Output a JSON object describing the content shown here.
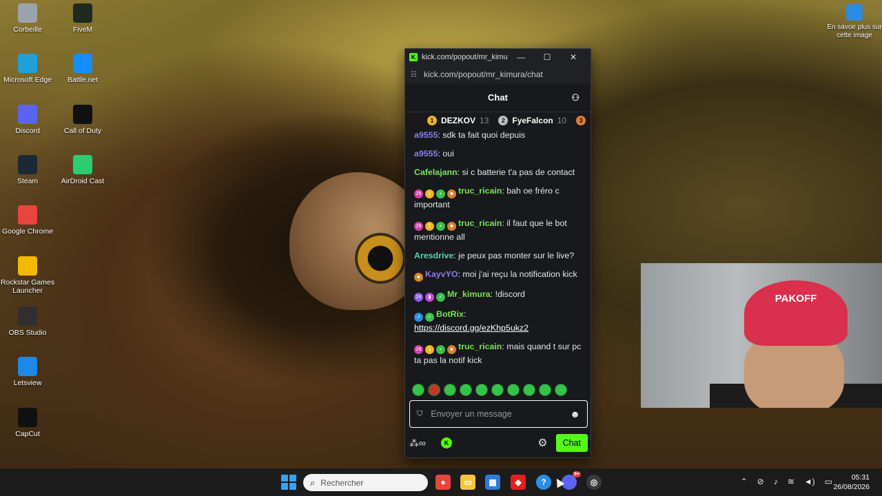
{
  "desktop": {
    "icons": [
      {
        "label": "Corbeille",
        "icon": "recycle-bin-icon",
        "color": "#9aa3ad"
      },
      {
        "label": "FiveM",
        "icon": "fivem-icon",
        "color": "#1f2a1f"
      },
      {
        "label": "Microsoft Edge",
        "icon": "edge-icon",
        "color": "#1fa0d8"
      },
      {
        "label": "Battle.net",
        "icon": "battlenet-icon",
        "color": "#148eff"
      },
      {
        "label": "Discord",
        "icon": "discord-icon",
        "color": "#5865f2"
      },
      {
        "label": "Call of Duty",
        "icon": "call-of-duty-icon",
        "color": "#111111"
      },
      {
        "label": "Steam",
        "icon": "steam-icon",
        "color": "#1b2838"
      },
      {
        "label": "AirDroid Cast",
        "icon": "airdroid-icon",
        "color": "#2ecc71"
      },
      {
        "label": "Google Chrome",
        "icon": "chrome-icon",
        "color": "#e8453c"
      },
      {
        "label": "Rockstar Games Launcher",
        "icon": "rockstar-icon",
        "color": "#f5b800"
      },
      {
        "label": "OBS Studio",
        "icon": "obs-icon",
        "color": "#302e31"
      },
      {
        "label": "Letsview",
        "icon": "letsview-icon",
        "color": "#1e88e5"
      },
      {
        "label": "CapCut",
        "icon": "capcut-icon",
        "color": "#111111"
      }
    ],
    "info_widget": "En savoir plus sur cette image"
  },
  "browser": {
    "tab_title": "kick.com/popout/mr_kimura...",
    "url": "kick.com/popout/mr_kimura/chat",
    "chat_title": "Chat",
    "leaderboard": [
      {
        "rank": "1",
        "name": "DEZKOV",
        "count": "13",
        "color": "#f0b429"
      },
      {
        "rank": "2",
        "name": "FyeFalcon",
        "count": "10",
        "color": "#c0c0c0"
      },
      {
        "rank": "3",
        "name": "",
        "count": "",
        "color": "#e07b39"
      }
    ],
    "messages": [
      {
        "user": "a9555",
        "text": " sdk ta fait quoi depuis",
        "color": "#8c7cf0",
        "badges": []
      },
      {
        "user": "a9555",
        "text": " oui",
        "color": "#8c7cf0",
        "badges": []
      },
      {
        "user": "Cafelajann",
        "text": " si c batterie t'a pas de contact",
        "color": "#7be35b",
        "badges": []
      },
      {
        "user": "truc_ricain",
        "text": " bah oe fréro c important",
        "color": "#7be35b",
        "badges": [
          "26",
          "1",
          "▪",
          "☻"
        ]
      },
      {
        "user": "truc_ricain",
        "text": " il faut que le bot mentionne all",
        "color": "#7be35b",
        "badges": [
          "26",
          "1",
          "▪",
          "☻"
        ]
      },
      {
        "user": "Aresdrive",
        "text": " je peux pas monter sur le live?",
        "color": "#5ed3b0",
        "badges": []
      },
      {
        "user": "KayvYO",
        "text": " moi j'ai reçu la notification kick",
        "color": "#8c7cf0",
        "badges": [
          "☻"
        ]
      },
      {
        "user": "Mr_kimura",
        "text": " !discord",
        "color": "#7be35b",
        "badges": [
          "24",
          "▮",
          "✓"
        ]
      },
      {
        "user": "BotRix",
        "text": "",
        "color": "#7be35b",
        "badges": [
          "➚",
          "✓"
        ],
        "link": "https://discord.gg/ezKhp5ukz2"
      },
      {
        "user": "truc_ricain",
        "text": " mais quand t sur pc ta pas la notif kick",
        "color": "#7be35b",
        "badges": [
          "26",
          "1",
          "▪",
          "☻"
        ]
      }
    ],
    "input_placeholder": "Envoyer un message",
    "send_label": "Chat"
  },
  "webcam": {
    "cap_text": "PAKOFF"
  },
  "taskbar": {
    "search_placeholder": "Rechercher",
    "discord_badge": "9+",
    "time": "05:31",
    "date": "26/08/2026"
  }
}
